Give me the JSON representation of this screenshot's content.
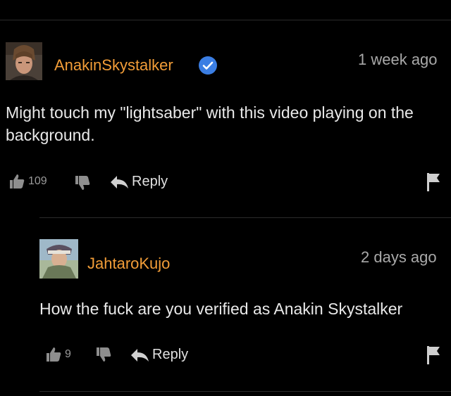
{
  "comments": [
    {
      "username": "AnakinSkystalker",
      "verified": true,
      "timestamp": "1 week ago",
      "text": "Might touch my \"lightsaber\" with this video playing on the background.",
      "likes": "109",
      "reply_label": "Reply"
    },
    {
      "username": "JahtaroKujo",
      "verified": false,
      "timestamp": "2 days ago",
      "text": "How the fuck are you verified as Anakin Skystalker",
      "likes": "9",
      "reply_label": "Reply"
    }
  ],
  "colors": {
    "background": "#000000",
    "username": "#f29d38",
    "verified_badge": "#3b7ee3",
    "text": "#e9e9e9",
    "muted": "#a9a9a9"
  },
  "icons": [
    "verified-badge-icon",
    "thumbs-up-icon",
    "thumbs-down-icon",
    "reply-arrow-icon",
    "flag-icon"
  ]
}
